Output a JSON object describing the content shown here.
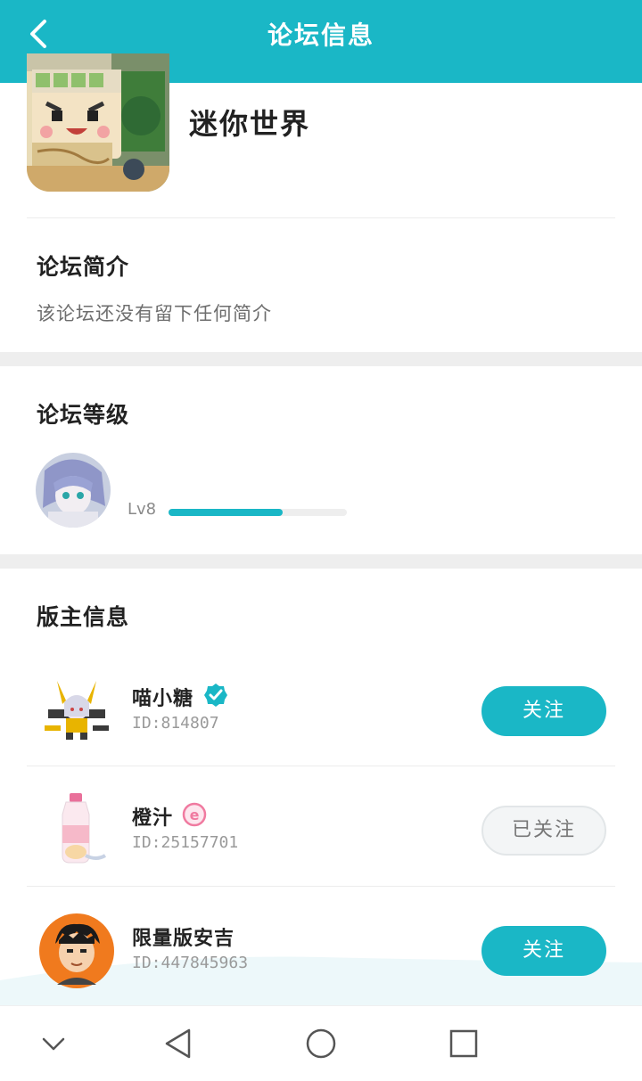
{
  "header": {
    "title": "论坛信息",
    "back_icon": "chevron-left-icon",
    "background": "#1ab7c6"
  },
  "forum": {
    "name": "迷你世界",
    "icon": "game-app-icon"
  },
  "intro": {
    "title": "论坛简介",
    "text": "该论坛还没有留下任何简介"
  },
  "level": {
    "title": "论坛等级",
    "label": "Lv8",
    "progress": 0.64,
    "accent": "#1ab7c6"
  },
  "moderators": {
    "title": "版主信息",
    "items": [
      {
        "name": "喵小糖",
        "id_text": "ID:814807",
        "badge": "verified-check-icon",
        "button": "关注",
        "followed": false
      },
      {
        "name": "橙汁",
        "id_text": "ID:25157701",
        "badge": "pink-e-badge-icon",
        "button": "已关注",
        "followed": true
      },
      {
        "name": "限量版安吉",
        "id_text": "ID:447845963",
        "badge": "",
        "button": "关注",
        "followed": false
      }
    ]
  },
  "navbar": {
    "items": [
      "collapse-chevron-icon",
      "back-triangle-icon",
      "home-circle-icon",
      "recents-square-icon"
    ]
  }
}
